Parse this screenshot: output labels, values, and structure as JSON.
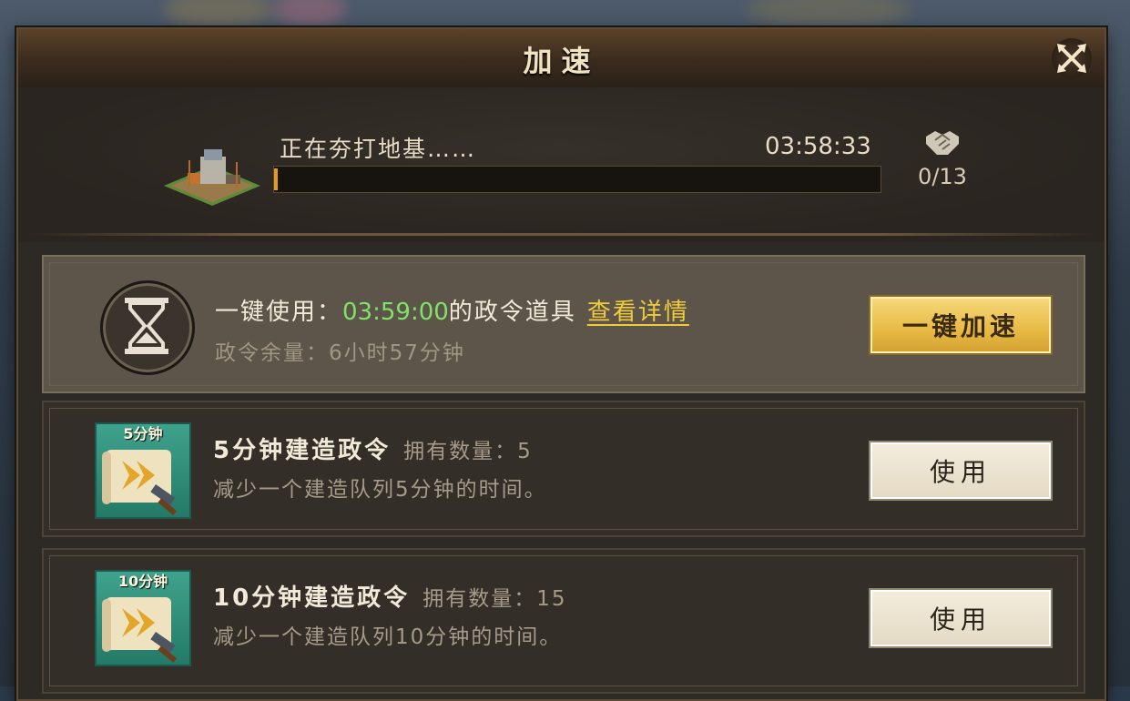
{
  "dialog": {
    "title": "加速",
    "close_icon": "close-x-icon"
  },
  "construction": {
    "status": "正在夯打地基……",
    "remaining_time": "03:58:33",
    "progress_fraction": 0.005,
    "help_icon": "handshake-icon",
    "help_count": "0/13"
  },
  "one_click": {
    "icon": "hourglass-icon",
    "label_prefix": "一键使用：",
    "duration": "03:59:00",
    "label_suffix": "的政令道具",
    "details_link": "查看详情",
    "remaining_label": "政令余量：6小时57分钟",
    "button_label": "一键加速"
  },
  "items": [
    {
      "badge": "5分钟",
      "name": "5分钟建造政令",
      "count_label": "拥有数量：5",
      "description": "减少一个建造队列5分钟的时间。",
      "button_label": "使用"
    },
    {
      "badge": "10分钟",
      "name": "10分钟建造政令",
      "count_label": "拥有数量：15",
      "description": "减少一个建造队列10分钟的时间。",
      "button_label": "使用"
    }
  ],
  "colors": {
    "accent_gold": "#e8ba45",
    "highlight_green": "#7fe36a",
    "link_yellow": "#f1cc3a",
    "progress_orange": "#e39a1f"
  }
}
